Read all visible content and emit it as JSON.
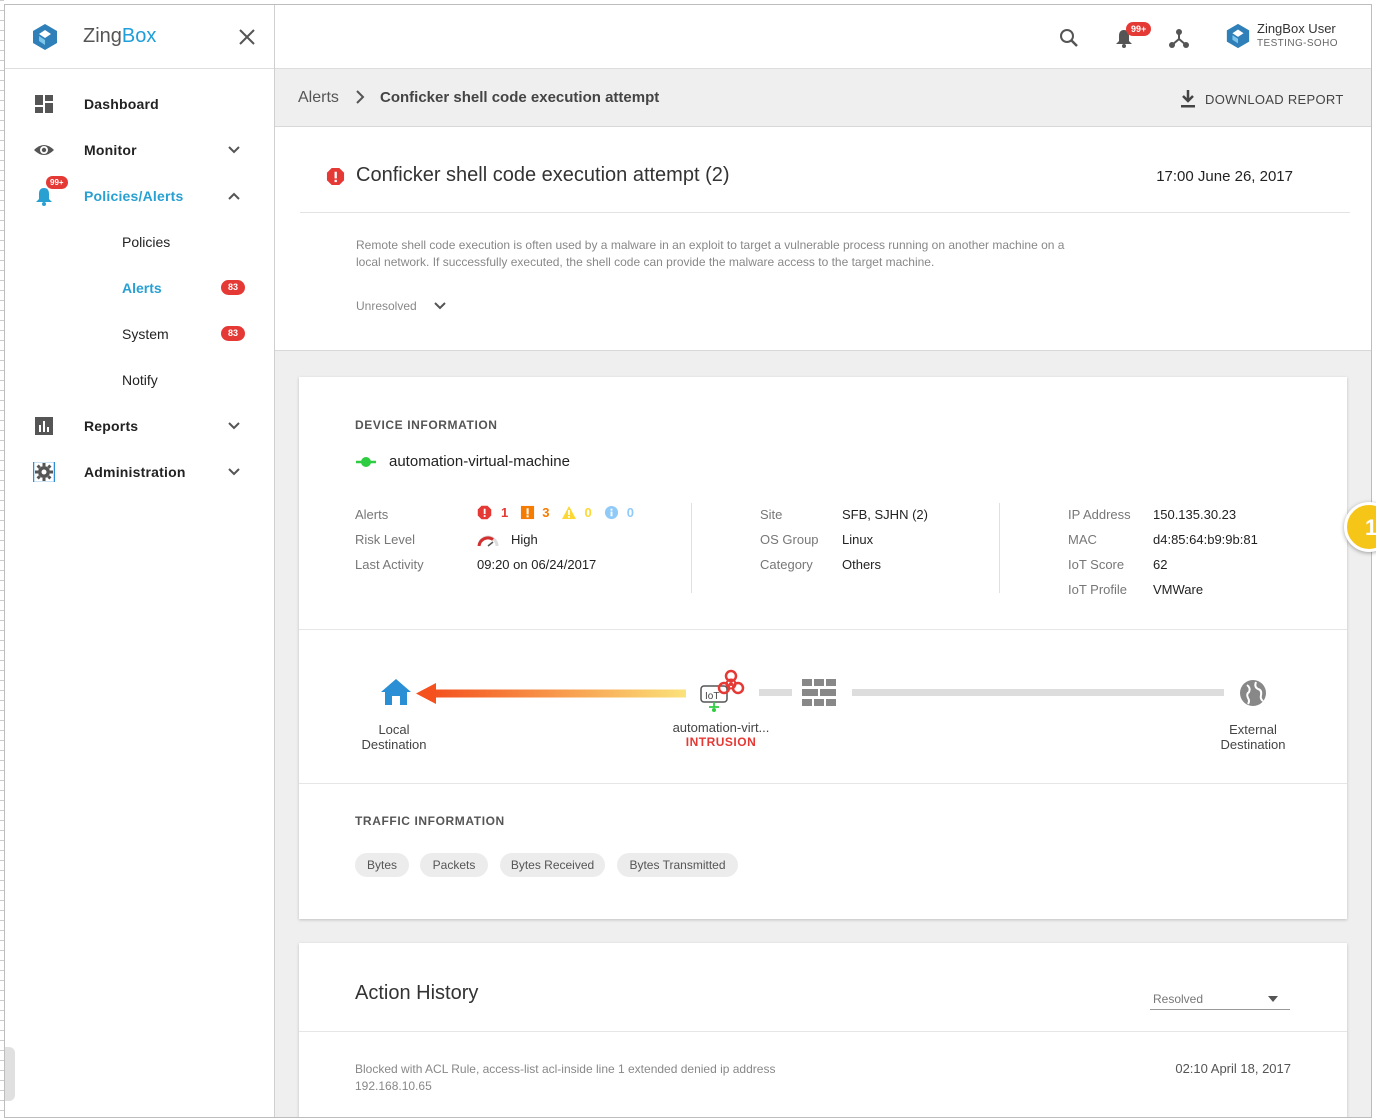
{
  "app": {
    "brand_prefix": "Zing",
    "brand_suffix": "Box"
  },
  "sidebar": {
    "items": [
      {
        "label": "Dashboard"
      },
      {
        "label": "Monitor"
      },
      {
        "label": "Policies/Alerts",
        "badge": "99+"
      },
      {
        "label": "Policies"
      },
      {
        "label": "Alerts",
        "count": "83"
      },
      {
        "label": "System",
        "count": "83"
      },
      {
        "label": "Notify"
      },
      {
        "label": "Reports"
      },
      {
        "label": "Administration"
      }
    ]
  },
  "topbar": {
    "notif_badge": "99+",
    "user_name": "ZingBox User",
    "user_org": "TESTING-SOHO"
  },
  "breadcrumb": {
    "root": "Alerts",
    "current": "Conficker shell code execution attempt",
    "download_label": "DOWNLOAD REPORT"
  },
  "alert": {
    "title": "Conficker shell code execution attempt (2)",
    "time": "17:00 June 26, 2017",
    "description": "Remote shell code execution is often used by a malware in an exploit to target a vulnerable process running on another machine on a local network. If successfully executed, the shell code can provide the malware access to the target machine.",
    "status": "Unresolved"
  },
  "device": {
    "section_title": "DEVICE INFORMATION",
    "name": "automation-virtual-machine",
    "labels": {
      "alerts": "Alerts",
      "risk": "Risk Level",
      "last_activity": "Last Activity",
      "site": "Site",
      "os_group": "OS Group",
      "category": "Category",
      "ip": "IP Address",
      "mac": "MAC",
      "iot_score": "IoT Score",
      "iot_profile": "IoT Profile"
    },
    "alert_counts": {
      "critical": "1",
      "warning": "3",
      "caution": "0",
      "info": "0"
    },
    "risk_level": "High",
    "last_activity": "09:20 on 06/24/2017",
    "site": "SFB, SJHN (2)",
    "os_group": "Linux",
    "category": "Others",
    "ip": "150.135.30.23",
    "mac": "d4:85:64:b9:9b:81",
    "iot_score": "62",
    "iot_profile": "VMWare"
  },
  "flow": {
    "local_line1": "Local",
    "local_line2": "Destination",
    "device": "automation-virt...",
    "intrusion": "INTRUSION",
    "iot_tag": "IoT",
    "external_line1": "External",
    "external_line2": "Destination"
  },
  "traffic": {
    "section_title": "TRAFFIC INFORMATION",
    "tabs": [
      "Bytes",
      "Packets",
      "Bytes Received",
      "Bytes Transmitted"
    ]
  },
  "history": {
    "title": "Action History",
    "filter": "Resolved",
    "entry_text": "Blocked with ACL Rule, access-list acl-inside line 1 extended denied ip address 192.168.10.65",
    "entry_time": "02:10 April 18, 2017"
  },
  "floating_badge": "1",
  "colors": {
    "accent": "#28a0d2",
    "danger": "#e53935",
    "warning": "#f57c00",
    "caution": "#fdd835",
    "info": "#90caf9",
    "online": "#2ecc40"
  }
}
